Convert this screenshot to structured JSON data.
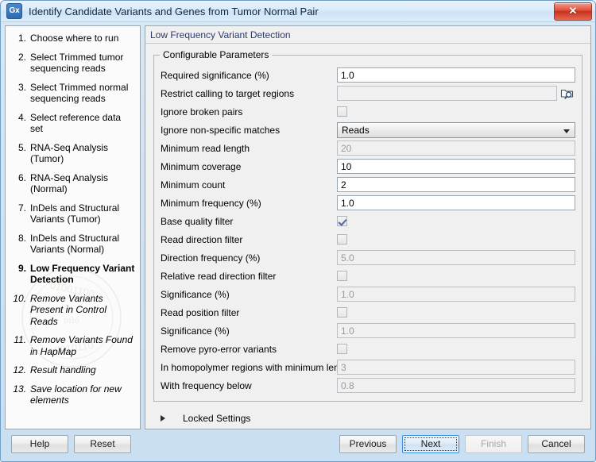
{
  "window": {
    "app_icon_text": "Gx",
    "title": "Identify Candidate Variants and Genes from Tumor Normal Pair",
    "close_glyph": "✕"
  },
  "sidebar": {
    "steps": [
      {
        "num": "1.",
        "label": "Choose where to run",
        "state": "past"
      },
      {
        "num": "2.",
        "label": "Select Trimmed tumor sequencing reads",
        "state": "past"
      },
      {
        "num": "3.",
        "label": "Select Trimmed normal sequencing reads",
        "state": "past"
      },
      {
        "num": "4.",
        "label": "Select reference data set",
        "state": "past"
      },
      {
        "num": "5.",
        "label": "RNA-Seq Analysis (Tumor)",
        "state": "past"
      },
      {
        "num": "6.",
        "label": "RNA-Seq Analysis (Normal)",
        "state": "past"
      },
      {
        "num": "7.",
        "label": "InDels and Structural Variants (Tumor)",
        "state": "past"
      },
      {
        "num": "8.",
        "label": "InDels and Structural Variants (Normal)",
        "state": "past"
      },
      {
        "num": "9.",
        "label": "Low Frequency Variant Detection",
        "state": "current"
      },
      {
        "num": "10.",
        "label": "Remove Variants Present in Control Reads",
        "state": "future"
      },
      {
        "num": "11.",
        "label": "Remove Variants Found in HapMap",
        "state": "future"
      },
      {
        "num": "12.",
        "label": "Result handling",
        "state": "future"
      },
      {
        "num": "13.",
        "label": "Save location for new elements",
        "state": "future"
      }
    ]
  },
  "main": {
    "panel_title": "Low Frequency Variant Detection",
    "group_title": "Configurable Parameters",
    "fields": [
      {
        "label": "Required significance (%)",
        "type": "text",
        "value": "1.0",
        "disabled": false,
        "name": "required-significance"
      },
      {
        "label": "Restrict calling to target regions",
        "type": "browse",
        "value": "",
        "disabled": true,
        "name": "restrict-calling-target-regions"
      },
      {
        "label": "Ignore broken pairs",
        "type": "checkbox",
        "checked": false,
        "disabled": false,
        "name": "ignore-broken-pairs"
      },
      {
        "label": "Ignore non-specific matches",
        "type": "combo",
        "value": "Reads",
        "disabled": false,
        "name": "ignore-non-specific-matches"
      },
      {
        "label": "Minimum read length",
        "type": "text",
        "value": "20",
        "disabled": true,
        "name": "minimum-read-length"
      },
      {
        "label": "Minimum coverage",
        "type": "text",
        "value": "10",
        "disabled": false,
        "name": "minimum-coverage"
      },
      {
        "label": "Minimum count",
        "type": "text",
        "value": "2",
        "disabled": false,
        "name": "minimum-count"
      },
      {
        "label": "Minimum frequency (%)",
        "type": "text",
        "value": "1.0",
        "disabled": false,
        "name": "minimum-frequency"
      },
      {
        "label": "Base quality filter",
        "type": "checkbox",
        "checked": true,
        "disabled": false,
        "name": "base-quality-filter"
      },
      {
        "label": "Read direction filter",
        "type": "checkbox",
        "checked": false,
        "disabled": false,
        "name": "read-direction-filter"
      },
      {
        "label": "Direction frequency (%)",
        "type": "text",
        "value": "5.0",
        "disabled": true,
        "name": "direction-frequency"
      },
      {
        "label": "Relative read direction filter",
        "type": "checkbox",
        "checked": false,
        "disabled": false,
        "name": "relative-read-direction-filter"
      },
      {
        "label": "Significance (%)",
        "type": "text",
        "value": "1.0",
        "disabled": true,
        "name": "relative-read-direction-significance"
      },
      {
        "label": "Read position filter",
        "type": "checkbox",
        "checked": false,
        "disabled": false,
        "name": "read-position-filter"
      },
      {
        "label": "Significance (%)",
        "type": "text",
        "value": "1.0",
        "disabled": true,
        "name": "read-position-significance"
      },
      {
        "label": "Remove pyro-error variants",
        "type": "checkbox",
        "checked": false,
        "disabled": false,
        "name": "remove-pyro-error-variants"
      },
      {
        "label": "In homopolymer regions with minimum length",
        "type": "text",
        "value": "3",
        "disabled": true,
        "name": "homopolymer-minimum-length"
      },
      {
        "label": "With frequency below",
        "type": "text",
        "value": "0.8",
        "disabled": true,
        "name": "with-frequency-below"
      }
    ],
    "locked_settings_label": "Locked Settings"
  },
  "footer": {
    "help": "Help",
    "reset": "Reset",
    "previous": "Previous",
    "next": "Next",
    "finish": "Finish",
    "cancel": "Cancel"
  },
  "colors": {
    "title_text": "#11283f",
    "panel_title_text": "#2c3a6b",
    "close_button": "#c9301c",
    "focus_border": "#3c8ddb",
    "checkmark": "#4a6a9c"
  }
}
